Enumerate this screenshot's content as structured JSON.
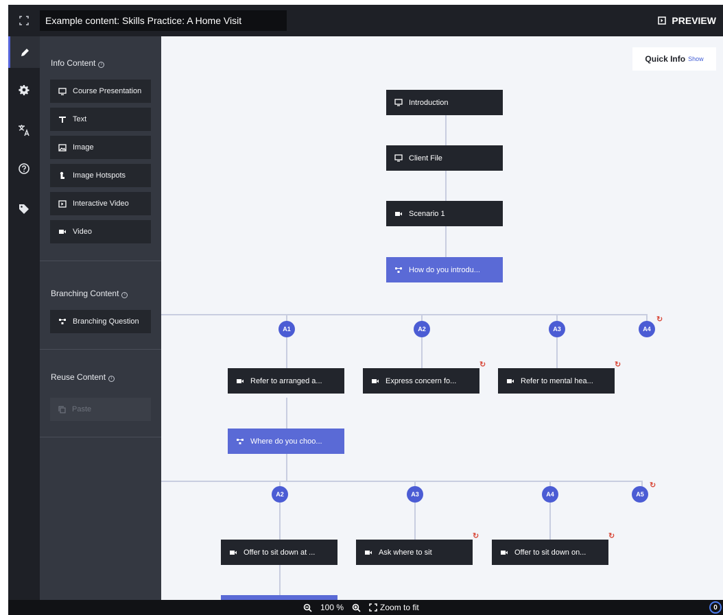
{
  "header": {
    "title": "Example content: Skills Practice: A Home Visit",
    "preview_label": "PREVIEW",
    "fullscreen_icon": "fullscreen-icon",
    "preview_icon": "preview-icon"
  },
  "sidebar": {
    "items": [
      {
        "name": "edit",
        "icon": "pencil-icon",
        "active": true
      },
      {
        "name": "settings",
        "icon": "gear-icon",
        "active": false
      },
      {
        "name": "translate",
        "icon": "translate-icon",
        "active": false
      },
      {
        "name": "help",
        "icon": "help-icon",
        "active": false
      },
      {
        "name": "tags",
        "icon": "tag-icon",
        "active": false
      }
    ]
  },
  "panel": {
    "info_content": {
      "heading": "Info Content",
      "items": [
        {
          "label": "Course Presentation",
          "icon": "presentation-icon"
        },
        {
          "label": "Text",
          "icon": "text-icon"
        },
        {
          "label": "Image",
          "icon": "image-icon"
        },
        {
          "label": "Image Hotspots",
          "icon": "hotspot-icon"
        },
        {
          "label": "Interactive Video",
          "icon": "interactive-video-icon"
        },
        {
          "label": "Video",
          "icon": "video-icon"
        }
      ]
    },
    "branching_content": {
      "heading": "Branching Content",
      "items": [
        {
          "label": "Branching Question",
          "icon": "branching-icon"
        }
      ]
    },
    "reuse_content": {
      "heading": "Reuse Content",
      "paste_label": "Paste"
    }
  },
  "canvas": {
    "quick_info": {
      "title": "Quick Info",
      "toggle": "Show"
    },
    "nodes": {
      "introduction": {
        "label": "Introduction",
        "icon": "presentation-icon"
      },
      "client_file": {
        "label": "Client File",
        "icon": "presentation-icon"
      },
      "scenario_1": {
        "label": "Scenario 1",
        "icon": "video-icon"
      },
      "question_1": {
        "label": "How do you introdu...",
        "icon": "branching-icon"
      },
      "a1_node": {
        "label": "Refer to arranged a...",
        "icon": "video-icon"
      },
      "a2_node": {
        "label": "Express concern fo...",
        "icon": "video-icon"
      },
      "a3_node": {
        "label": "Refer to mental hea...",
        "icon": "video-icon"
      },
      "question_2": {
        "label": "Where do you choo...",
        "icon": "branching-icon"
      },
      "b2_node": {
        "label": "Offer to sit down at ...",
        "icon": "video-icon"
      },
      "b3_node": {
        "label": "Ask where to sit",
        "icon": "video-icon"
      },
      "b4_node": {
        "label": "Offer to sit down on...",
        "icon": "video-icon"
      }
    },
    "alternatives_1": [
      "A1",
      "A2",
      "A3",
      "A4"
    ],
    "alternatives_2": [
      "A2",
      "A3",
      "A4",
      "A5"
    ],
    "loop_icon": "loop-icon"
  },
  "footer": {
    "zoom_out_icon": "zoom-out-icon",
    "zoom_level": "100 %",
    "zoom_in_icon": "zoom-in-icon",
    "zoom_fit_label": "Zoom to fit",
    "counter": "0"
  },
  "colors": {
    "dark": "#1e2026",
    "panel": "#343841",
    "node": "#22252c",
    "branch_node": "#5a6ad6",
    "badge": "#4b5cd4",
    "loop": "#d94b3c",
    "connector": "#c8cde0"
  }
}
